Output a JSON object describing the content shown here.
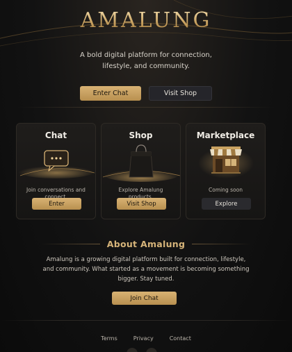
{
  "brand": {
    "name": "AMALUNG"
  },
  "hero": {
    "tagline": "A bold digital platform for connection, lifestyle, and community.",
    "primary_button": "Enter Chat",
    "secondary_button": "Visit Shop"
  },
  "cards": [
    {
      "title": "Chat",
      "description": "Join conversations and connect.",
      "button": "Enter",
      "icon": "chat-bubble-icon"
    },
    {
      "title": "Shop",
      "description": "Explore Amalung products.",
      "button": "Visit Shop",
      "icon": "shopping-bag-icon"
    },
    {
      "title": "Marketplace",
      "description": "Coming soon",
      "button": "Explore",
      "icon": "storefront-icon"
    }
  ],
  "about": {
    "title": "About Amalung",
    "text": "Amalung is a growing digital platform built for connection, lifestyle, and community. What started as a movement is becoming something bigger. Stay tuned.",
    "button": "Join Chat"
  },
  "footer": {
    "links": [
      "Terms",
      "Privacy",
      "Contact"
    ]
  },
  "colors": {
    "accent": "#c9a261",
    "background": "#121212",
    "card": "#1c1a18"
  }
}
